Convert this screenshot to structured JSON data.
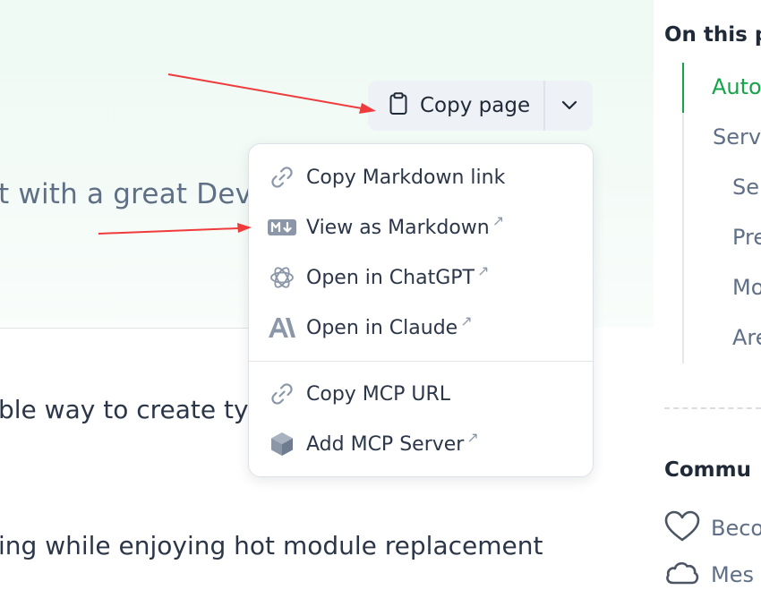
{
  "hero": {
    "subtitle": "t with a great Dev"
  },
  "body": {
    "line1": "ble way to create ty",
    "line2": "ing while enjoying hot module replacement"
  },
  "copy_page": {
    "label": "Copy page"
  },
  "menu": {
    "items": [
      {
        "label": "Copy Markdown link",
        "icon": "link-icon",
        "external": ""
      },
      {
        "label": "View as Markdown",
        "icon": "markdown-icon",
        "external": "↗"
      },
      {
        "label": "Open in ChatGPT",
        "icon": "chatgpt-icon",
        "external": "↗"
      },
      {
        "label": "Open in Claude",
        "icon": "claude-icon",
        "external": "↗"
      },
      {
        "label": "Copy MCP URL",
        "icon": "link-icon",
        "external": ""
      },
      {
        "label": "Add MCP Server",
        "icon": "cube-icon",
        "external": "↗"
      }
    ]
  },
  "toc": {
    "title": "On this p",
    "items": [
      {
        "label": "Auto",
        "active": true
      },
      {
        "label": "Serv",
        "active": false
      },
      {
        "label": "Se",
        "active": false
      },
      {
        "label": "Pre",
        "active": false
      },
      {
        "label": "Mo",
        "active": false
      },
      {
        "label": "Are",
        "active": false
      }
    ]
  },
  "community": {
    "title": "Commu",
    "items": [
      {
        "label": "Beco",
        "icon": "heart-icon"
      },
      {
        "label": "Mes",
        "icon": "cloud-icon"
      }
    ]
  },
  "colors": {
    "accent": "#16a34a",
    "annotation_arrow": "#ef3b3b"
  }
}
